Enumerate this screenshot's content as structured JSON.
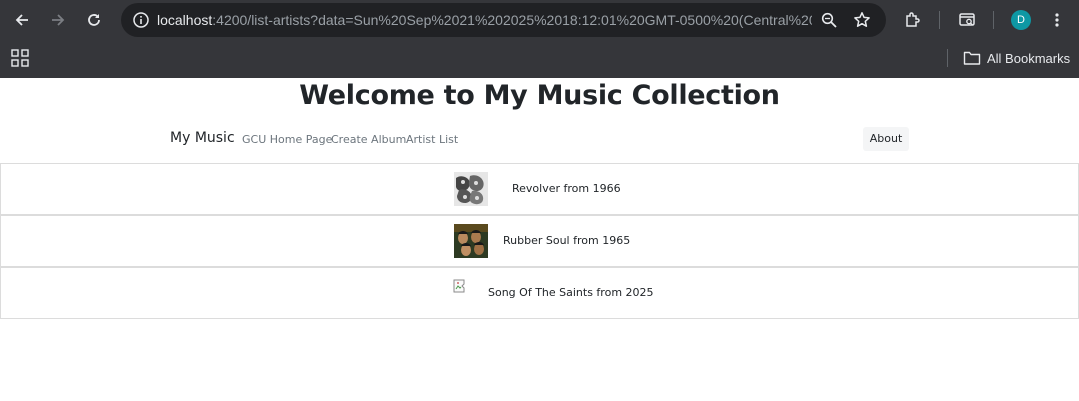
{
  "browser": {
    "url_host": "localhost",
    "url_rest": ":4200/list-artists?data=Sun%20Sep%2021%202025%2018:12:01%20GMT-0500%20(Central%20...",
    "profile_initial": "D",
    "bookmarks_label": "All Bookmarks",
    "icons": [
      "back-icon",
      "forward-icon",
      "reload-icon",
      "site-info-icon",
      "zoom-icon",
      "star-icon",
      "extensions-icon",
      "tab-search-icon",
      "menu-icon",
      "apps-icon",
      "folder-icon"
    ]
  },
  "page": {
    "title": "Welcome to My Music Collection"
  },
  "navbar": {
    "brand": "My Music",
    "links": [
      "GCU Home Page",
      "Create Album",
      "Artist List"
    ],
    "about": "About"
  },
  "albums": [
    {
      "label": "Revolver from 1966",
      "cover": "revolver-cover"
    },
    {
      "label": "Rubber Soul from 1965",
      "cover": "rubber-soul-cover"
    },
    {
      "label": "Song Of The Saints from 2025",
      "cover": "broken-image"
    }
  ],
  "colors": {
    "chrome_bg": "#35363a",
    "omnibox_bg": "#202124",
    "avatar_bg": "#0e98a4",
    "row_border": "#dcdcdc",
    "nav_link": "#6c757d"
  }
}
